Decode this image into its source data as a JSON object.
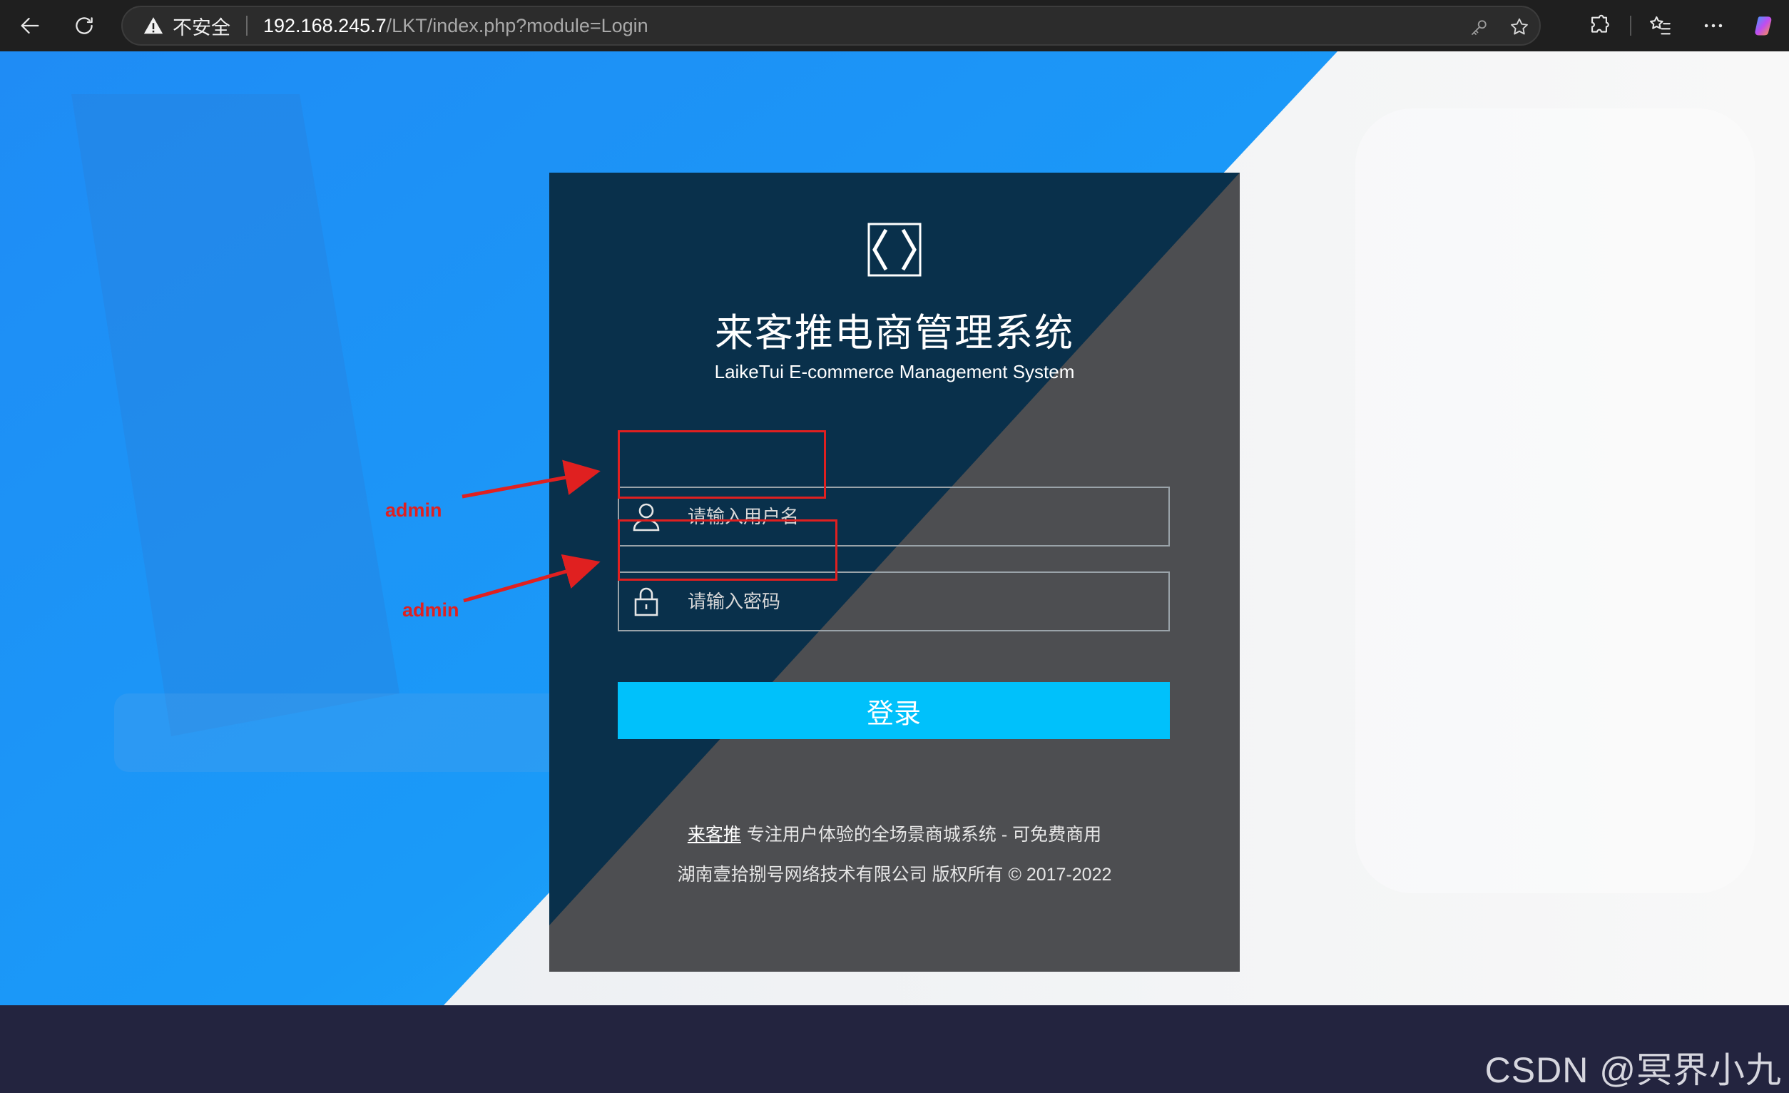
{
  "browser": {
    "security_label": "不安全",
    "url_host": "192.168.245.7",
    "url_path": "/LKT/index.php?module=Login"
  },
  "colors": {
    "brand_blue": "#1a8cff",
    "panel_dark": "#0a2d46",
    "login_button": "#00c1fb",
    "annotation_red": "#e02020",
    "footer": "#23243f"
  },
  "icons": {
    "back": "back-arrow-icon",
    "refresh": "refresh-icon",
    "warning": "warning-icon",
    "key": "key-icon",
    "favorite": "star-icon",
    "extensions": "puzzle-icon",
    "favorites_list": "favorites-list-icon",
    "more": "more-icon",
    "copilot": "copilot-icon",
    "logo": "code-bracket-logo-icon",
    "user": "user-icon",
    "lock": "lock-icon"
  },
  "login": {
    "title": "来客推电商管理系统",
    "subtitle": "LaikeTui E-commerce Management System",
    "username_placeholder": "请输入用户名",
    "password_placeholder": "请输入密码",
    "submit_label": "登录",
    "footer_brand": "来客推",
    "footer_tagline": "专注用户体验的全场景商城系统 - 可免费商用",
    "footer_copyright": "湖南壹拾捌号网络技术有限公司 版权所有 © 2017-2022"
  },
  "annotations": {
    "username_hint": "admin",
    "password_hint": "admin"
  },
  "watermark": "CSDN @冥界小九"
}
